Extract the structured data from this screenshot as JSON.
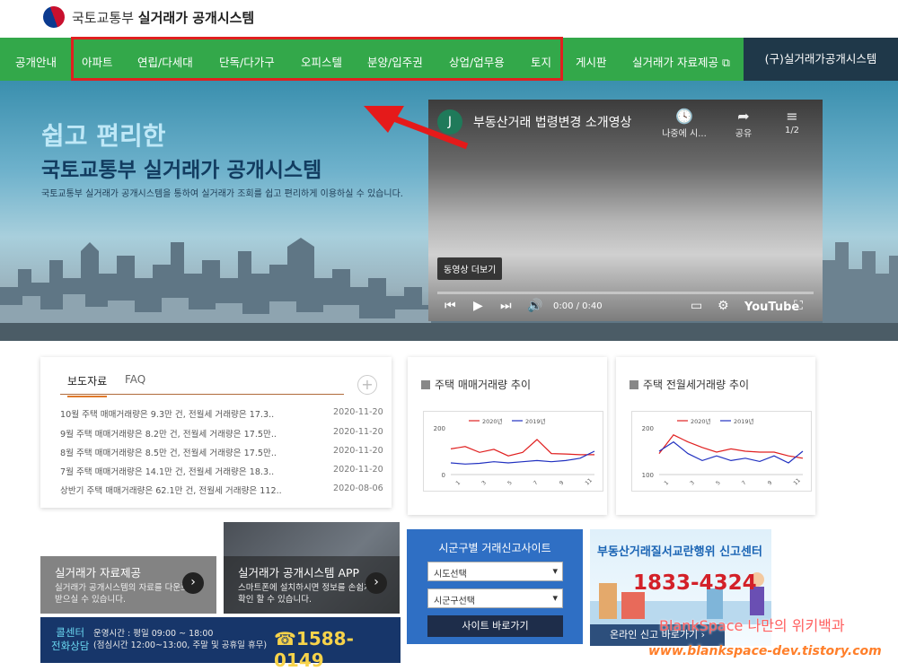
{
  "header": {
    "org": "국토교통부",
    "system": "실거래가 공개시스템"
  },
  "gnb": {
    "items": [
      "공개안내",
      "아파트",
      "연립/다세대",
      "단독/다가구",
      "오피스텔",
      "분양/입주권",
      "상업/업무용",
      "토지",
      "게시판",
      "실거래가 자료제공 ⧉"
    ],
    "old_system": "(구)실거래가공개시스템"
  },
  "hero": {
    "subtitle": "쉽고 편리한",
    "title": "국토교통부 실거래가 공개시스템",
    "desc": "국토교통부 실거래가 공개시스템을 통하여 실거래가 조회를 쉽고 편리하게 이용하실 수 있습니다."
  },
  "video": {
    "avatar": "J",
    "title": "부동산거래 법령변경 소개영상",
    "later": "나중에 시...",
    "share": "공유",
    "playlist": "1/2",
    "more": "동영상 더보기",
    "time": "0:00 / 0:40",
    "brand": "YouTube"
  },
  "news": {
    "tabs": [
      "보도자료",
      "FAQ"
    ],
    "plus": "+",
    "rows": [
      {
        "title": "10월 주택 매매거래량은 9.3만 건, 전월세 거래량은 17.3..",
        "date": "2020-11-20"
      },
      {
        "title": "9월 주택 매매거래량은 8.2만 건, 전월세 거래량은 17.5만..",
        "date": "2020-11-20"
      },
      {
        "title": "8월 주택 매매거래량은 8.5만 건, 전월세 거래량은 17.5만..",
        "date": "2020-11-20"
      },
      {
        "title": "7월 주택 매매거래량은 14.1만 건, 전월세 거래량은 18.3..",
        "date": "2020-11-20"
      },
      {
        "title": "상반기 주택 매매거래량은 62.1만 건, 전월세 거래량은 112..",
        "date": "2020-08-06"
      }
    ]
  },
  "chart_data": [
    {
      "type": "line",
      "title": "주택 매매거래량 추이",
      "categories": [
        "1",
        "3",
        "5",
        "7",
        "9",
        "11"
      ],
      "ylim": [
        0,
        200
      ],
      "yticks": [
        "200",
        "0"
      ],
      "series": [
        {
          "name": "2020년",
          "color": "#e02020",
          "values": [
            110,
            120,
            95,
            108,
            80,
            95,
            150,
            90,
            88,
            85,
            85
          ]
        },
        {
          "name": "2019년",
          "color": "#2030c0",
          "values": [
            50,
            45,
            48,
            55,
            50,
            55,
            60,
            55,
            60,
            70,
            100
          ]
        }
      ]
    },
    {
      "type": "line",
      "title": "주택 전월세거래량 추이",
      "categories": [
        "1",
        "3",
        "5",
        "7",
        "9",
        "11"
      ],
      "ylim": [
        100,
        200
      ],
      "yticks": [
        "200",
        "100"
      ],
      "series": [
        {
          "name": "2020년",
          "color": "#e02020",
          "values": [
            145,
            185,
            170,
            158,
            148,
            155,
            150,
            148,
            148,
            140,
            135
          ]
        },
        {
          "name": "2019년",
          "color": "#2030c0",
          "values": [
            150,
            170,
            145,
            130,
            140,
            130,
            135,
            128,
            140,
            125,
            150
          ]
        }
      ]
    }
  ],
  "tiles": [
    {
      "title": "실거래가 자료제공",
      "desc": "실거래가 공개시스템의 자료를 다운로드 받으실 수 있습니다.",
      "btn": "›"
    },
    {
      "title": "실거래가 공개시스템 APP",
      "desc": "스마트폰에 설치하시면 정보를 손쉽게 확인 할 수 있습니다.",
      "btn": "›"
    }
  ],
  "callcenter": {
    "label1": "콜센터",
    "label2": "전화상담",
    "hours": "운영시간 : 평일 09:00 ~ 18:00",
    "lunch": "(점심시간 12:00~13:00, 주말 및 공휴일 휴무)",
    "phone": "☎1588-0149"
  },
  "region": {
    "title": "시군구별 거래신고사이트",
    "sido": "시도선택",
    "sigungu": "시군구선택",
    "button": "사이트 바로가기"
  },
  "report": {
    "title": "부동산거래질서교란행위 신고센터",
    "phone": "1833-4324",
    "button": "온라인 신고 바로가기 ›"
  },
  "watermark": {
    "line1": "BlankSpace 나만의 위키백과",
    "line2": "www.blankspace-dev.tistory.com"
  }
}
